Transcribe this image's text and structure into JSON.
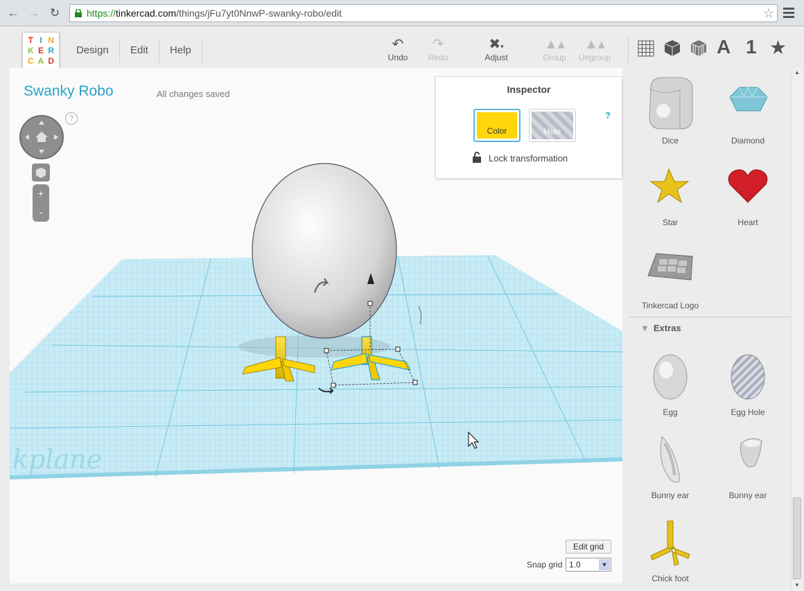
{
  "browser": {
    "url_scheme": "https://",
    "url_host": "tinkercad.com",
    "url_path": "/things/jFu7yt0NnwP-swanky-robo/edit"
  },
  "logo": {
    "letters": [
      "T",
      "I",
      "N",
      "K",
      "E",
      "R",
      "C",
      "A",
      "D"
    ],
    "colors": [
      "#e4312b",
      "#2aa3c9",
      "#f6a81b",
      "#8ac43f",
      "#e4312b",
      "#2aa3c9",
      "#f6a81b",
      "#8ac43f",
      "#e4312b"
    ]
  },
  "menu": {
    "design": "Design",
    "edit": "Edit",
    "help": "Help"
  },
  "toolbar": {
    "undo": "Undo",
    "redo": "Redo",
    "adjust": "Adjust",
    "group": "Group",
    "ungroup": "Ungroup"
  },
  "view": {
    "text_icon": "A",
    "number_icon": "1"
  },
  "project": {
    "title": "Swanky Robo",
    "status": "All changes saved"
  },
  "inspector": {
    "title": "Inspector",
    "color_label": "Color",
    "hole_label": "Hole",
    "help": "?",
    "lock_label": "Lock transformation",
    "color_value": "#ffd60a"
  },
  "nav": {
    "help": "?",
    "zoom_in": "+",
    "zoom_out": "-"
  },
  "workplane": {
    "label": "kplane"
  },
  "grid": {
    "edit_label": "Edit grid",
    "snap_label": "Snap grid",
    "snap_value": "1.0"
  },
  "sidebar": {
    "shapes": [
      {
        "label": "Dice",
        "icon": "dice-icon"
      },
      {
        "label": "Diamond",
        "icon": "diamond-icon"
      },
      {
        "label": "Star",
        "icon": "star-icon"
      },
      {
        "label": "Heart",
        "icon": "heart-icon"
      },
      {
        "label": "Tinkercad Logo",
        "icon": "tinkercad-logo-icon"
      }
    ],
    "extras_title": "Extras",
    "extras": [
      {
        "label": "Egg",
        "icon": "egg-icon"
      },
      {
        "label": "Egg Hole",
        "icon": "egg-hole-icon"
      },
      {
        "label": "Bunny ear",
        "icon": "bunny-ear-icon"
      },
      {
        "label": "Bunny ear",
        "icon": "bunny-ear-2-icon"
      },
      {
        "label": "Chick foot",
        "icon": "chick-foot-icon"
      }
    ]
  }
}
